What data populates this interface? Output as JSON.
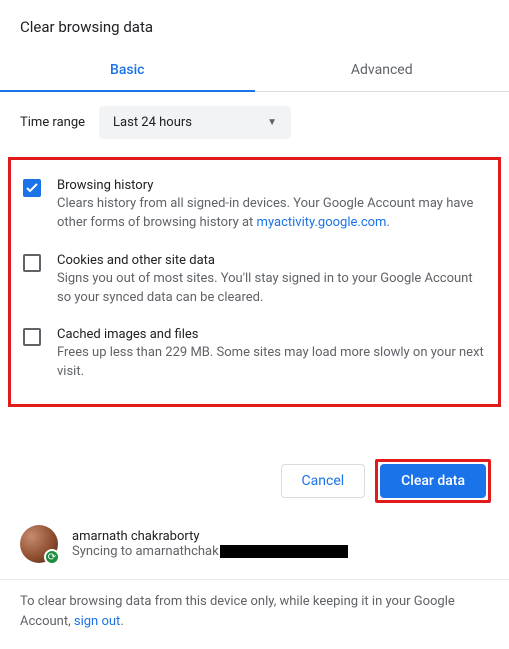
{
  "dialog": {
    "title": "Clear browsing data"
  },
  "tabs": {
    "basic": "Basic",
    "advanced": "Advanced"
  },
  "timerange": {
    "label": "Time range",
    "value": "Last 24 hours"
  },
  "options": {
    "history": {
      "title": "Browsing history",
      "desc_pre": "Clears history from all signed-in devices. Your Google Account may have other forms of browsing history at ",
      "link": "myactivity.google.com",
      "desc_post": ".",
      "checked": true
    },
    "cookies": {
      "title": "Cookies and other site data",
      "desc": "Signs you out of most sites. You'll stay signed in to your Google Account so your synced data can be cleared.",
      "checked": false
    },
    "cache": {
      "title": "Cached images and files",
      "desc": "Frees up less than 229 MB. Some sites may load more slowly on your next visit.",
      "checked": false
    }
  },
  "actions": {
    "cancel": "Cancel",
    "clear": "Clear data"
  },
  "profile": {
    "name": "amarnath chakraborty",
    "syncing_prefix": "Syncing to amarnathchak"
  },
  "footer": {
    "text_pre": "To clear browsing data from this device only, while keeping it in your Google Account, ",
    "link": "sign out",
    "text_post": "."
  }
}
